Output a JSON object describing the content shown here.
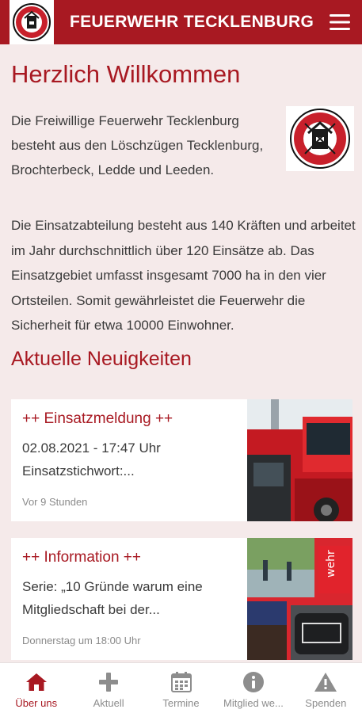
{
  "header": {
    "title": "FEUERWEHR TECKLENBURG",
    "logo_icon": "fire-brigade-emblem",
    "menu_icon": "hamburger-menu-icon"
  },
  "main": {
    "welcome_title": "Herzlich Willkommen",
    "intro_paragraph": "Die Freiwillige Feuerwehr Tecklenburg besteht aus den Löschzügen Tecklenburg, Brochterbeck, Ledde und Leeden.",
    "details_paragraph": "Die Einsatzabteilung besteht aus 140 Kräften und arbeitet im Jahr durchschnittlich über 120 Einsätze ab. Das Einsatzgebiet umfasst insgesamt 7000 ha in den vier Ortsteilen.  Somit gewährleistet die Feuerwehr die Sicherheit für etwa 10000 Einwohner.",
    "news_heading": "Aktuelle Neuigkeiten"
  },
  "news": [
    {
      "title": "++ Einsatzmeldung ++",
      "excerpt": "02.08.2021 - 17:47 Uhr Einsatzstichwort:...",
      "meta": "Vor 9 Stunden",
      "image": "fire-truck-photo"
    },
    {
      "title": "++ Information ++",
      "excerpt": "Serie: „10 Gründe warum eine Mitgliedschaft bei der...",
      "meta": "Donnerstag um 18:00 Uhr",
      "image": "collage-photo"
    }
  ],
  "bottom_nav": [
    {
      "label": "Über uns",
      "icon": "home-icon",
      "active": true
    },
    {
      "label": "Aktuell",
      "icon": "plus-icon",
      "active": false
    },
    {
      "label": "Termine",
      "icon": "calendar-icon",
      "active": false
    },
    {
      "label": "Mitglied we...",
      "icon": "info-icon",
      "active": false
    },
    {
      "label": "Spenden",
      "icon": "warning-icon",
      "active": false
    }
  ],
  "colors": {
    "brand": "#a81922",
    "background": "#f5eaea",
    "inactive": "#8d8d8d"
  }
}
